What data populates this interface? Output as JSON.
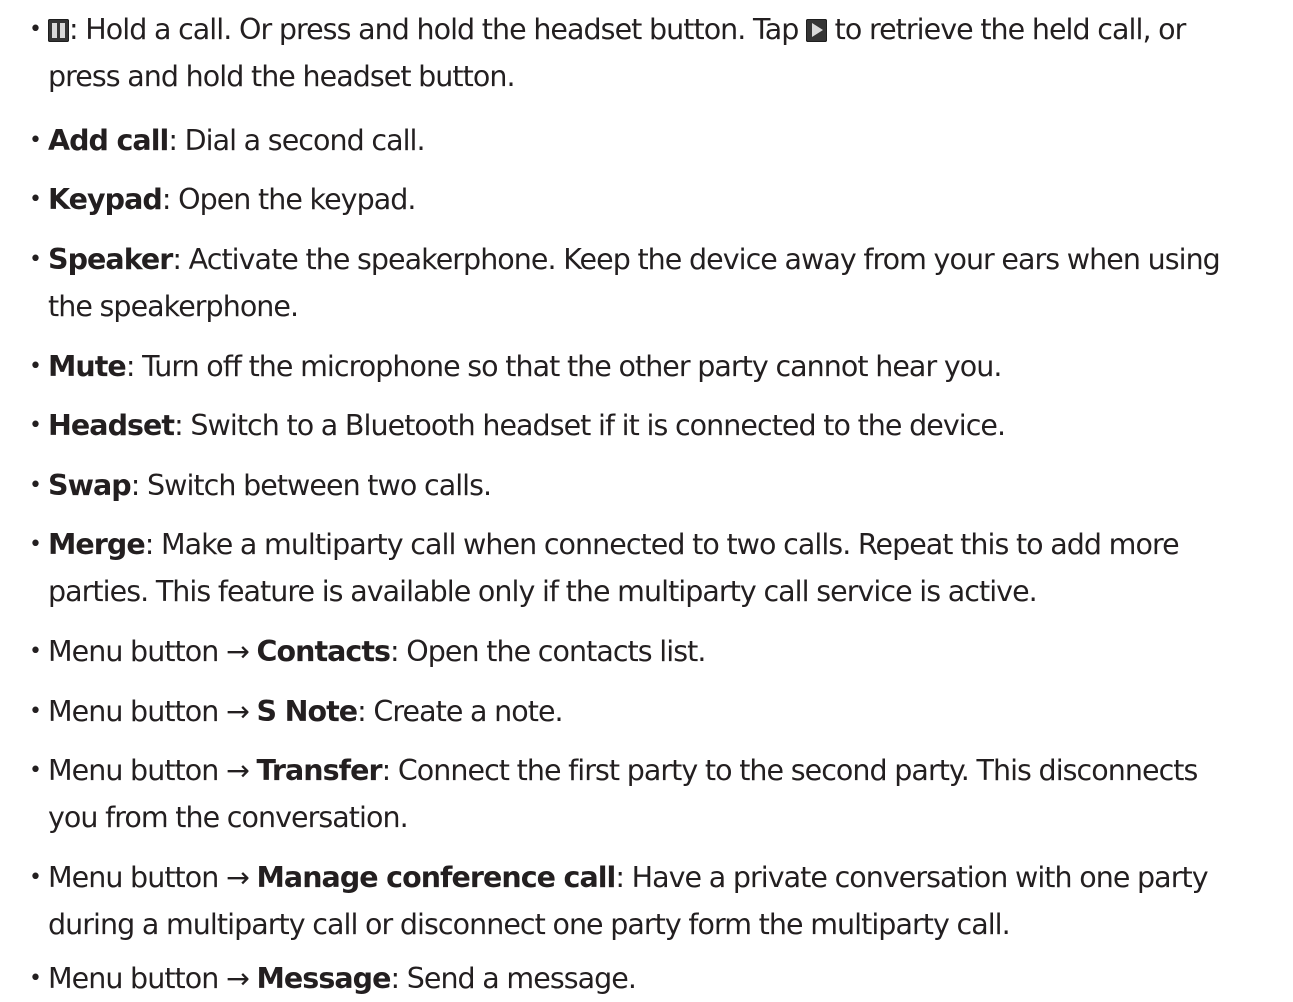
{
  "bullet_char": "•",
  "items": [
    {
      "icon_name": "pause-icon",
      "text1": ": Hold a call. Or press and hold the headset button. Tap ",
      "icon2_name": "play-icon",
      "text2": " to retrieve the held call, or",
      "line2": "press and hold the headset button."
    },
    {
      "term": "Add call",
      "desc": ": Dial a second call."
    },
    {
      "term": "Keypad",
      "desc": ": Open the keypad."
    },
    {
      "term": "Speaker",
      "desc": ": Activate the speakerphone. Keep the device away from your ears when using",
      "line2": "the speakerphone."
    },
    {
      "term": "Mute",
      "desc": ": Turn off the microphone so that the other party cannot hear you."
    },
    {
      "term": "Headset",
      "desc": ": Switch to a Bluetooth headset if it is connected to the device."
    },
    {
      "term": "Swap",
      "desc": ": Switch between two calls."
    },
    {
      "term": "Merge",
      "desc": ": Make a multiparty call when connected to two calls. Repeat this to add more",
      "line2": "parties. This feature is available only if the multiparty call service is active."
    },
    {
      "prefix": "Menu button → ",
      "term": "Contacts",
      "desc": ": Open the contacts list."
    },
    {
      "prefix": "Menu button → ",
      "term": "S Note",
      "desc": ": Create a note."
    },
    {
      "prefix": "Menu button → ",
      "term": "Transfer",
      "desc": ": Connect the first party to the second party. This disconnects",
      "line2": "you from the conversation."
    },
    {
      "prefix": "Menu button → ",
      "term": "Manage conference call",
      "desc": ": Have a private conversation with one party",
      "line2": "during a multiparty call or disconnect one party form the multiparty call."
    },
    {
      "prefix": "Menu button → ",
      "term": "Message",
      "desc": ": Send a message."
    }
  ]
}
